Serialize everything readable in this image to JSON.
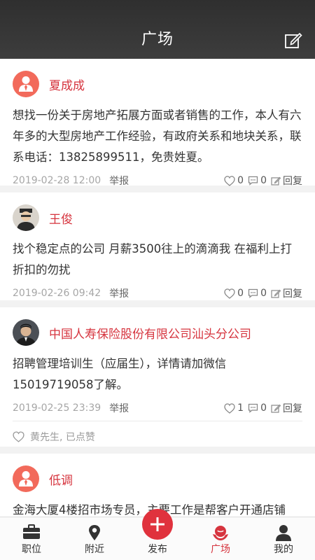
{
  "header": {
    "title": "广场"
  },
  "posts": [
    {
      "author": "夏成成",
      "avatar": "default-user-avatar",
      "content": "想找一份关于房地产拓展方面或者销售的工作，本人有六年多的大型房地产工作经验，有政府关系和地块关系，联系电话：13825899511，免贵姓夏。",
      "date": "2019-02-28 12:00",
      "report": "举报",
      "likes": "0",
      "comments": "0",
      "reply": "回复"
    },
    {
      "author": "王俊",
      "avatar": "photo-avatar",
      "content": "找个稳定点的公司 月薪3500往上的滴滴我 在福利上打折扣的勿扰",
      "date": "2019-02-26 09:42",
      "report": "举报",
      "likes": "0",
      "comments": "0",
      "reply": "回复"
    },
    {
      "author": "中国人寿保险股份有限公司汕头分公司",
      "avatar": "photo-avatar",
      "content": "招聘管理培训生（应届生），详情请加微信15019719058了解。",
      "date": "2019-02-25 23:39",
      "report": "举报",
      "likes": "1",
      "comments": "0",
      "reply": "回复",
      "liked_by": "黄先生, 已点赞"
    },
    {
      "author": "低调",
      "avatar": "default-user-avatar",
      "content": "金海大厦4楼招市场专员，主要工作是帮客户开通店铺"
    }
  ],
  "tabs": [
    {
      "label": "职位",
      "icon": "briefcase-icon"
    },
    {
      "label": "附近",
      "icon": "location-pin-icon"
    },
    {
      "label": "发布",
      "icon": "plus-icon"
    },
    {
      "label": "广场",
      "icon": "plaza-icon",
      "active": true
    },
    {
      "label": "我的",
      "icon": "user-icon"
    }
  ],
  "colors": {
    "accent": "#d6343e",
    "header_bg": "#333333",
    "avatar_default": "#f26a5b"
  }
}
